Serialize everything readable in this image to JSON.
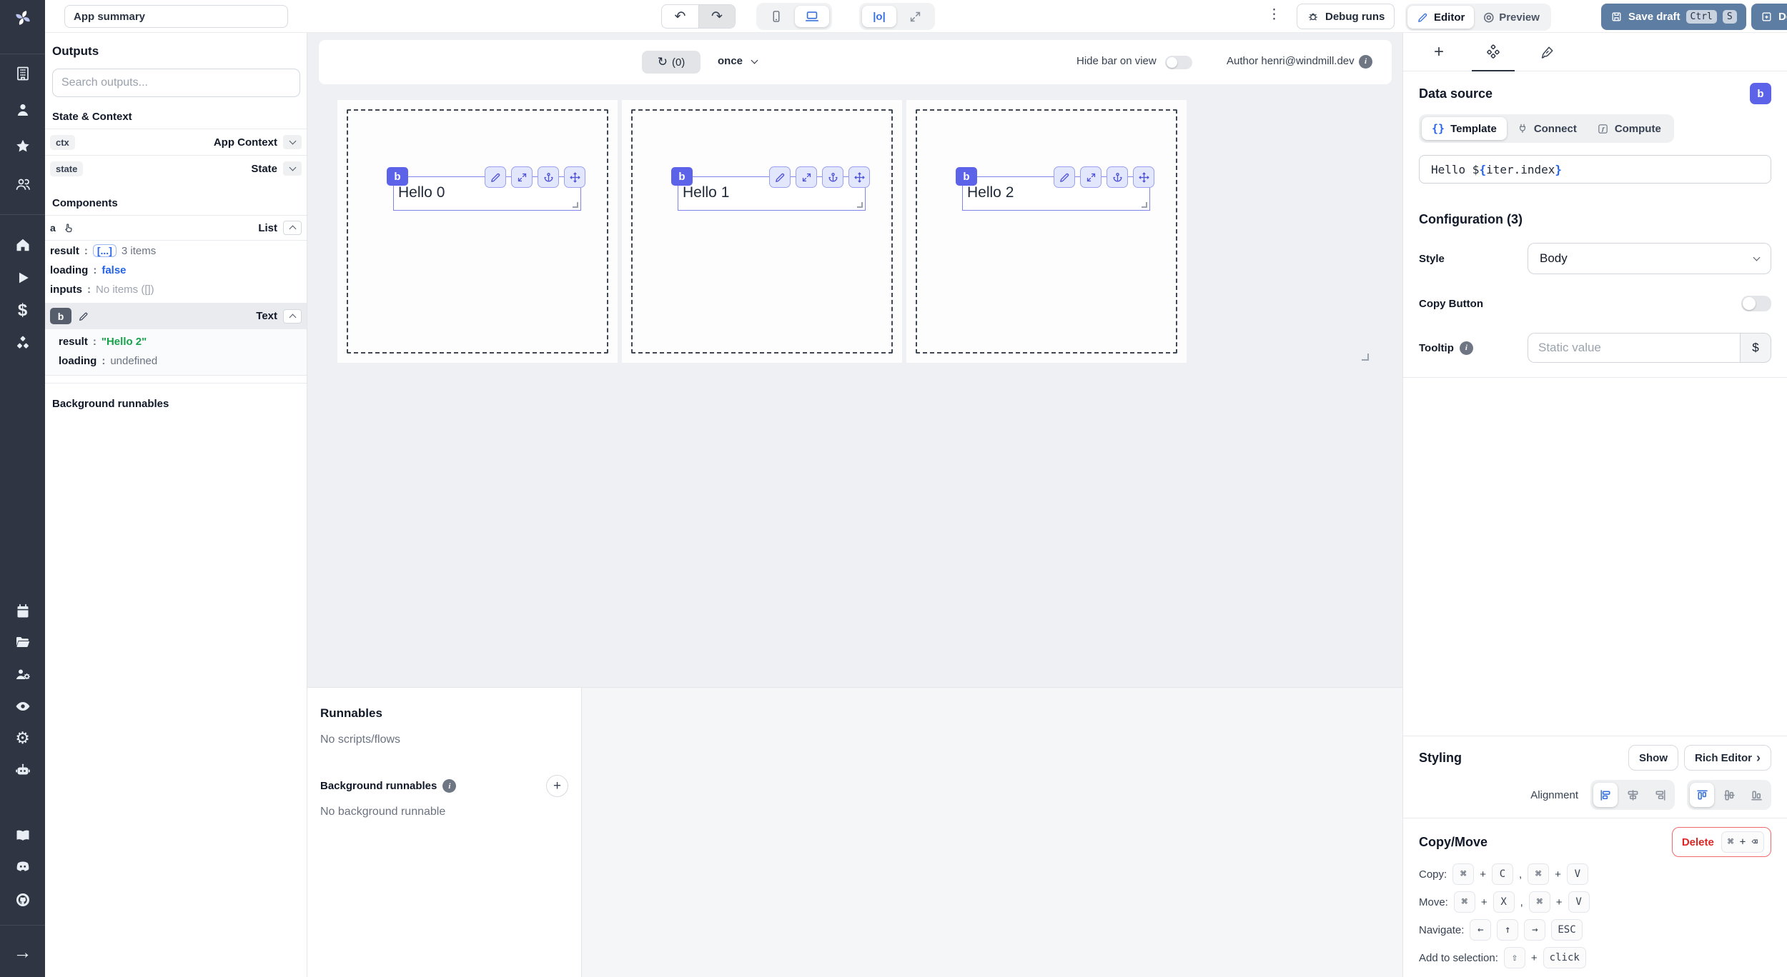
{
  "header": {
    "app_summary_value": "App summary",
    "debug_runs": "Debug runs",
    "editor": "Editor",
    "preview": "Preview",
    "preview_icon": "◎",
    "save_draft": "Save draft",
    "kbd_ctrl": "Ctrl",
    "kbd_s": "S",
    "deploy": "Deploy",
    "undo_icon": "↶",
    "redo_icon": "↷",
    "center_align_icon": "|o|",
    "kebab_icon": "⋮"
  },
  "outputs_panel": {
    "title": "Outputs",
    "search_placeholder": "Search outputs...",
    "state_context_title": "State & Context",
    "ctx_key": "ctx",
    "ctx_type": "App Context",
    "state_key": "state",
    "state_type": "State",
    "components_title": "Components",
    "colon": ":",
    "comp_a": {
      "id": "a",
      "type": "List",
      "result_label": "result",
      "result_chip": "[...]",
      "result_note": "3 items",
      "loading_label": "loading",
      "loading_value": "false",
      "inputs_label": "inputs",
      "inputs_value": "No items ([])"
    },
    "comp_b": {
      "id": "b",
      "type": "Text",
      "result_label": "result",
      "result_value": "\"Hello 2\"",
      "loading_label": "loading",
      "loading_value": "undefined"
    },
    "background_title": "Background runnables"
  },
  "canvas": {
    "refresh_icon": "↻",
    "refresh_count": "(0)",
    "frequency": "once",
    "hide_bar_label": "Hide bar on view",
    "author_label": "Author henri@windmill.dev",
    "info_icon": "i",
    "badge": "b",
    "items": [
      {
        "label": "Hello 0"
      },
      {
        "label": "Hello 1"
      },
      {
        "label": "Hello 2"
      }
    ]
  },
  "runnables": {
    "title": "Runnables",
    "empty": "No scripts/flows",
    "background_title": "Background runnables",
    "background_empty": "No background runnable",
    "add_icon": "+"
  },
  "inspector": {
    "plus_tab_icon": "+",
    "data_source_title": "Data source",
    "badge": "b",
    "template_icon": "{}",
    "tab_template": "Template",
    "tab_connect": "Connect",
    "tab_compute": "Compute",
    "compute_icon": "ƒ",
    "code": {
      "p1": "Hello $",
      "b1": "{",
      "p2": "iter.index",
      "b2": "}"
    },
    "configuration_title": "Configuration (3)",
    "style_label": "Style",
    "style_value": "Body",
    "copy_button_label": "Copy Button",
    "tooltip_label": "Tooltip",
    "tooltip_placeholder": "Static value",
    "dollar_button": "$",
    "info_icon": "i",
    "styling_title": "Styling",
    "show_button": "Show",
    "rich_editor_button": "Rich Editor",
    "rich_editor_chevron": "›",
    "alignment_label": "Alignment",
    "copy_move_title": "Copy/Move",
    "delete_button": "Delete",
    "delete_kbd": "⌘ + ⌫",
    "shortcut_copy_label": "Copy:",
    "shortcut_move_label": "Move:",
    "shortcut_navigate_label": "Navigate:",
    "shortcut_add_label": "Add to selection:",
    "key_cmd": "⌘",
    "key_c": "C",
    "key_v": "V",
    "key_x": "X",
    "key_left": "←",
    "key_up": "↑",
    "key_right": "→",
    "key_esc": "ESC",
    "key_shift": "⇧",
    "key_click": "click",
    "plus": "+",
    "comma": ","
  },
  "colors": {
    "rail_bg": "#2f3542",
    "accent_blue": "#3a72dd",
    "indigo": "#5d63e8",
    "action_slate": "#5e7da2",
    "danger_red": "#dc2626",
    "value_green": "#16a34a",
    "value_blue": "#2563eb",
    "canvas_bg": "#eef0f3"
  }
}
